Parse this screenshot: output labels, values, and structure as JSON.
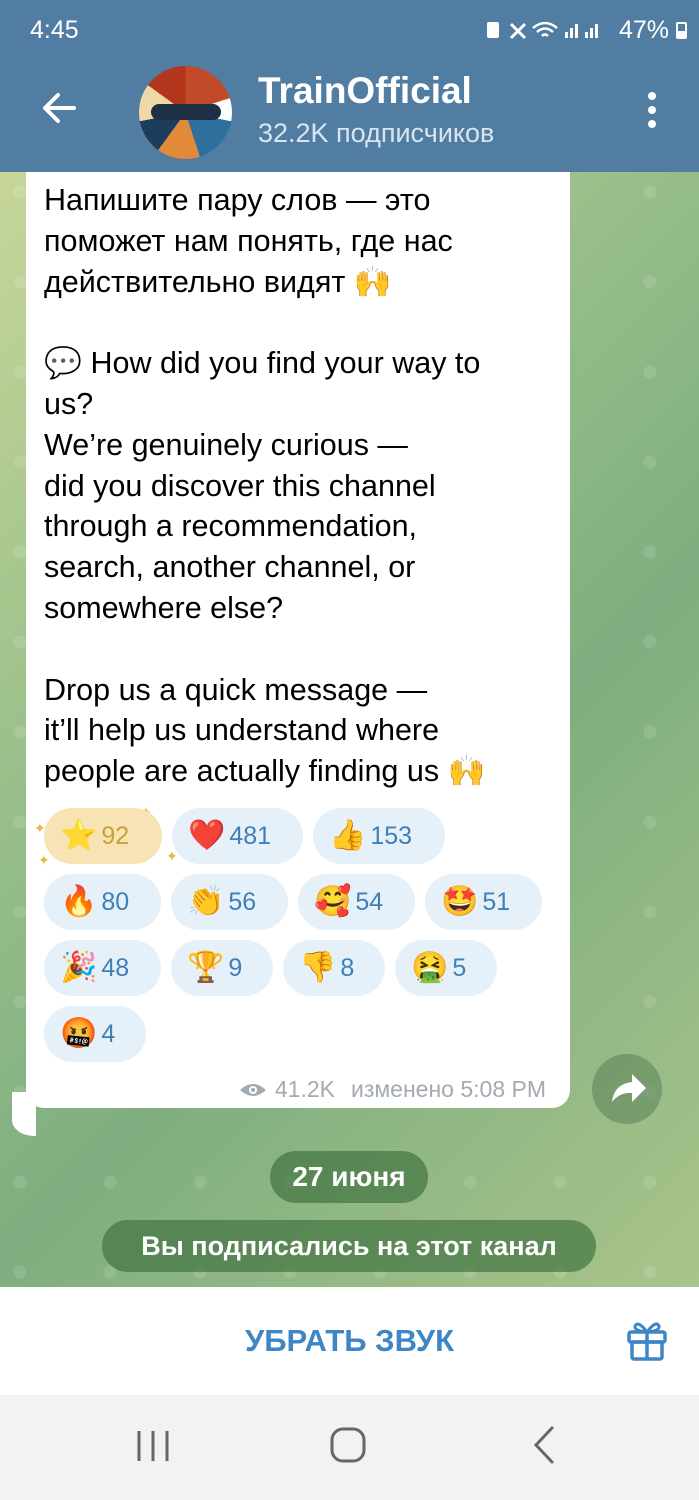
{
  "status_bar": {
    "time": "4:45",
    "battery": "47%"
  },
  "header": {
    "title": "TrainOfficial",
    "subtitle": "32.2K подписчиков"
  },
  "message": {
    "text": "Напишите пару слов — это\nпоможет нам понять, где нас\nдействительно видят 🙌\n\n💬 How did you find your way to\nus?\nWe’re genuinely curious —\ndid you discover this channel\nthrough a recommendation,\nsearch, another channel, or\nsomewhere else?\n\nDrop us a quick message —\nit’ll help us understand where\npeople are actually finding us 🙌",
    "views": "41.2K",
    "edited_time": "изменено 5:08 PM",
    "reactions": [
      {
        "emoji": "⭐",
        "count": "92",
        "selected": true
      },
      {
        "emoji": "❤️",
        "count": "481"
      },
      {
        "emoji": "👍",
        "count": "153"
      },
      {
        "emoji": "🔥",
        "count": "80"
      },
      {
        "emoji": "👏",
        "count": "56"
      },
      {
        "emoji": "🥰",
        "count": "54"
      },
      {
        "emoji": "🤩",
        "count": "51"
      },
      {
        "emoji": "🎉",
        "count": "48"
      },
      {
        "emoji": "🏆",
        "count": "9"
      },
      {
        "emoji": "👎",
        "count": "8"
      },
      {
        "emoji": "🤮",
        "count": "5"
      },
      {
        "emoji": "🤬",
        "count": "4"
      }
    ]
  },
  "date_label": "27 июня",
  "service_message": "Вы подписались на этот канал",
  "bottom_bar": {
    "mute_label": "УБРАТЬ ЗВУК"
  },
  "colors": {
    "header_bg": "#517da2",
    "accent": "#3e86c6",
    "reaction_bg": "#e6f0f8",
    "reaction_selected_bg": "#f7e3b4",
    "chat_bg": "#9ec28c"
  }
}
